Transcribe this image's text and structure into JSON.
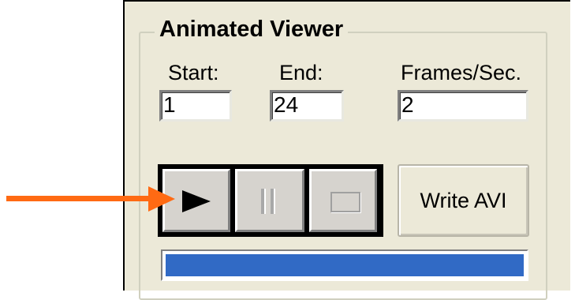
{
  "group": {
    "title": "Animated Viewer"
  },
  "fields": {
    "start": {
      "label": "Start:",
      "value": "1"
    },
    "end": {
      "label": "End:",
      "value": "24"
    },
    "fps": {
      "label": "Frames/Sec.",
      "value": "2"
    }
  },
  "controls": {
    "play_icon": "play-icon",
    "pause_icon": "pause-icon",
    "stop_icon": "stop-icon",
    "write_label": "Write AVI"
  },
  "progress": {
    "value": 1.0,
    "color": "#316ac5"
  },
  "annotation": {
    "arrow_color": "#ff6a13"
  }
}
